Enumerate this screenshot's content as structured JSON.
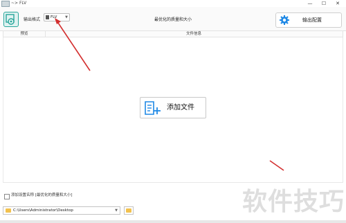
{
  "window": {
    "title": "~> FLV",
    "minimize": "—",
    "maximize": "☐",
    "close": "✕"
  },
  "toolbar": {
    "format_label": "输出格式",
    "format_value": "FLV",
    "center_text": "最优化的质量和大小",
    "output_button_label": "输出配置",
    "icons": {
      "format": "video-format-icon",
      "output": "gear-icon"
    }
  },
  "table": {
    "columns": [
      "预览",
      "文件信息"
    ]
  },
  "main": {
    "add_file_label": "添加文件",
    "add_icon": "add-file-icon"
  },
  "footer": {
    "checkbox_label": "添加设置名称 [最优化的质量和大小]",
    "checkbox_checked": false,
    "path_value": "C:\\Users\\Administrator\\Desktop",
    "folder_icon": "folder-icon"
  },
  "watermark": "软件技巧",
  "colors": {
    "accent": "#26a69a",
    "gear": "#1e88e5",
    "arrow": "#d32f2f"
  }
}
